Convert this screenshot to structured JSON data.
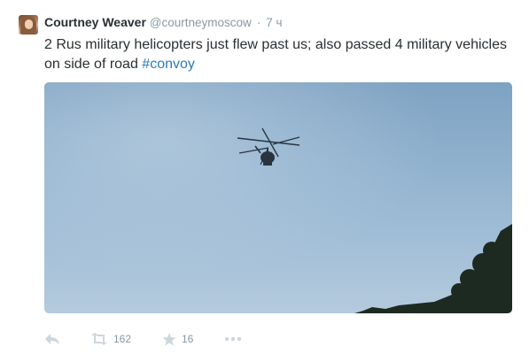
{
  "tweet": {
    "author_name": "Courtney Weaver",
    "author_handle": "@courtneymoscow",
    "separator": "·",
    "time": "7 ч",
    "text_main": "2 Rus military helicopters just flew past us; also passed 4 military vehicles on side of road ",
    "hashtag": "#convoy",
    "retweet_count": "162",
    "favorite_count": "16"
  },
  "icons": {
    "reply": "reply-icon",
    "retweet": "retweet-icon",
    "favorite": "star-icon",
    "more": "more-dots-icon"
  },
  "colors": {
    "text": "#292f33",
    "muted": "#8899a6",
    "link": "#2b7bb9",
    "action_icon": "#ccd6dd"
  }
}
